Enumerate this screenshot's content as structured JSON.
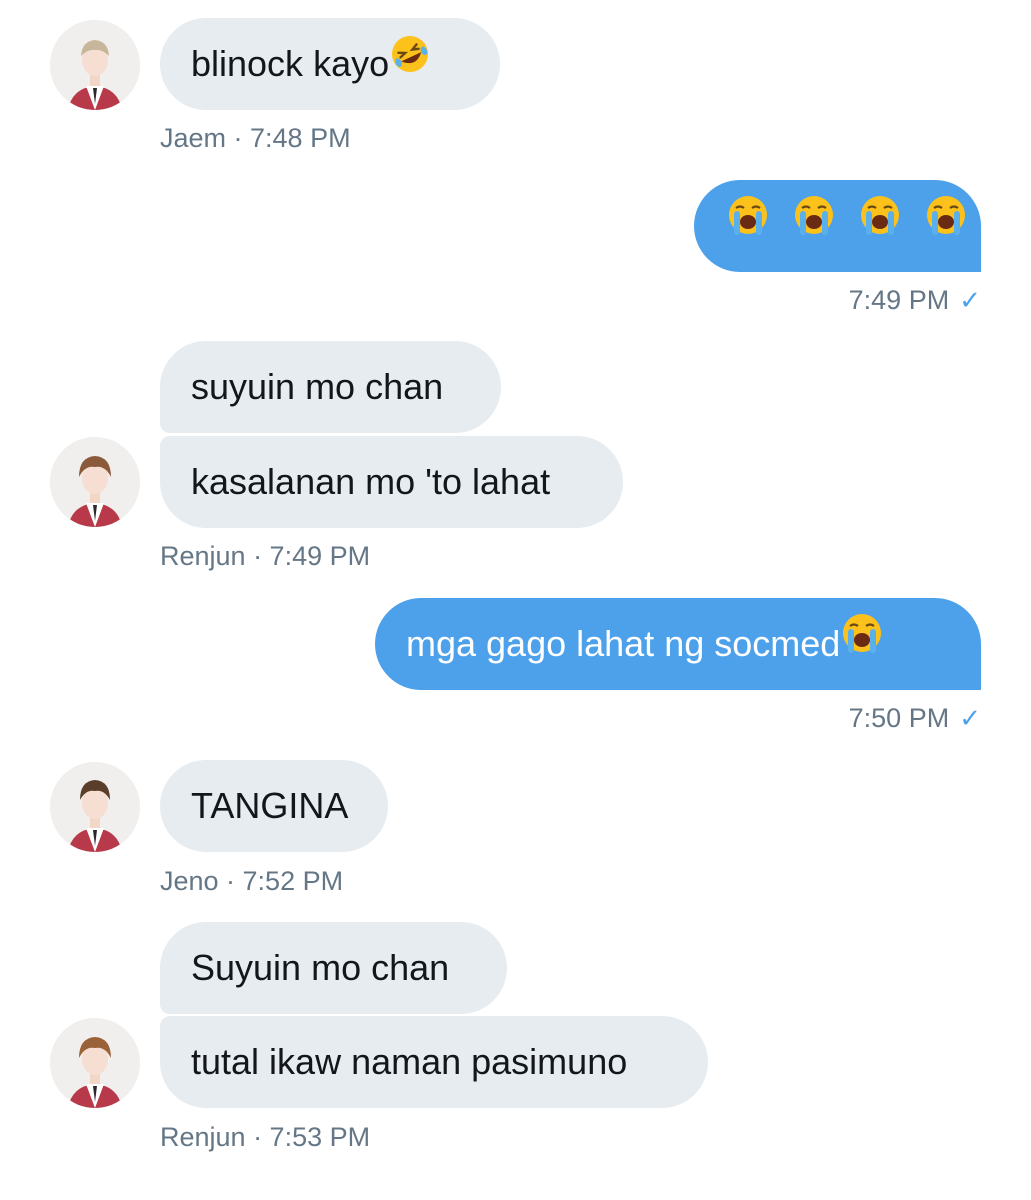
{
  "messages": [
    {
      "text": "blinock kayo",
      "emoji": "rofl-emoji"
    },
    {
      "emoji": "crying-emoji",
      "emoji_count": 4
    },
    {
      "text": "suyuin mo chan"
    },
    {
      "text": "kasalanan mo 'to lahat"
    },
    {
      "text": "mga gago lahat ng socmed",
      "emoji": "crying-emoji"
    },
    {
      "text": "TANGINA"
    },
    {
      "text": "Suyuin mo chan"
    },
    {
      "text": "tutal ikaw naman pasimuno"
    }
  ],
  "meta": {
    "m0": "Jaem · 7:48 PM",
    "m1": "7:49 PM",
    "m2": "Renjun · 7:49 PM",
    "m3": "7:50 PM",
    "m4": "Jeno · 7:52 PM",
    "m5": "Renjun · 7:53 PM"
  },
  "read_mark": "✓",
  "colors": {
    "incoming_bubble": "#e6ecf0",
    "outgoing_bubble": "#4da1eb",
    "meta_text": "#657786",
    "jacket_red": "#b83a4a"
  }
}
